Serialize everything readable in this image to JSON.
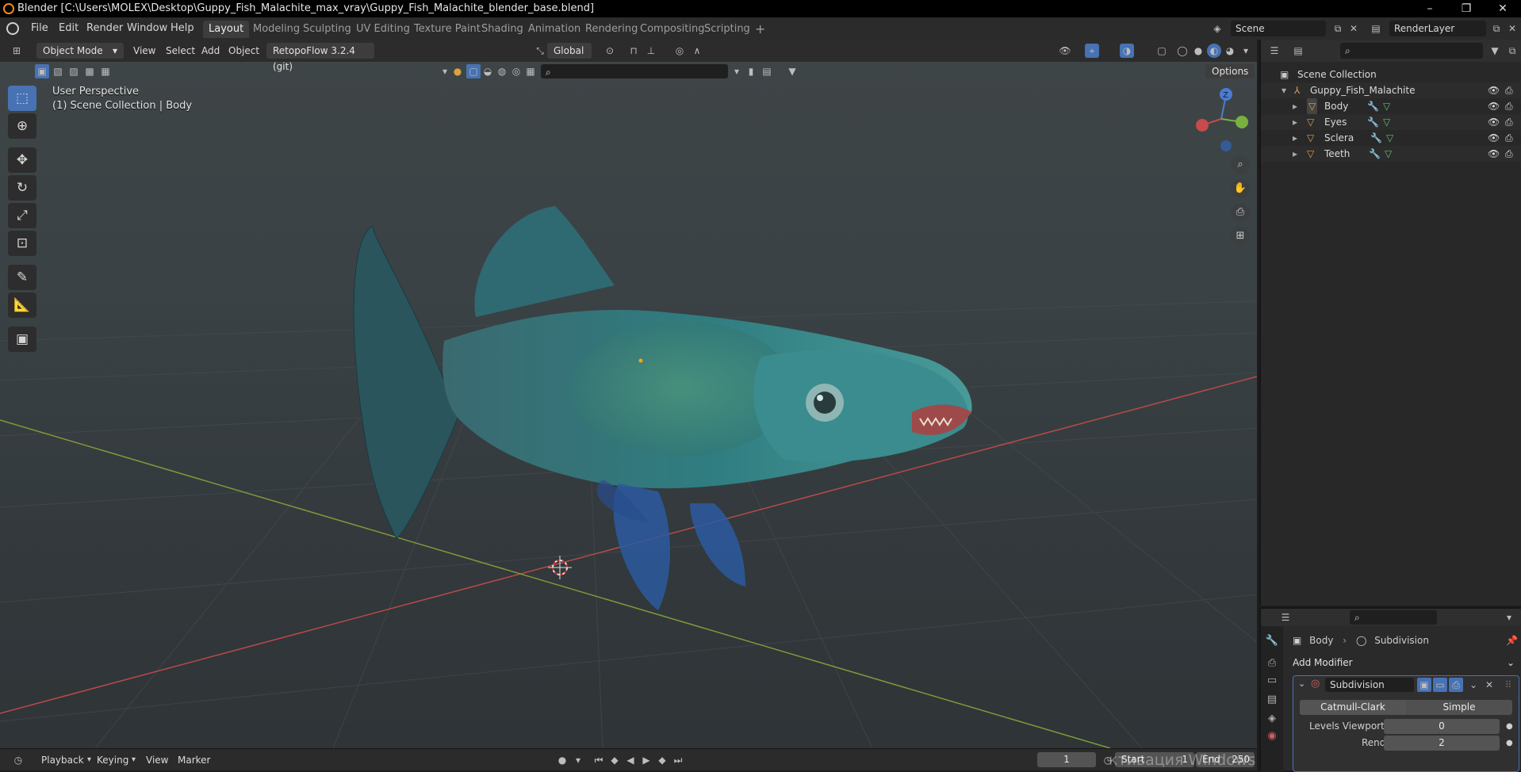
{
  "window": {
    "title": "Blender [C:\\Users\\MOLEX\\Desktop\\Guppy_Fish_Malachite_max_vray\\Guppy_Fish_Malachite_blender_base.blend]",
    "minimize": "–",
    "restore": "❐",
    "close": "✕"
  },
  "menu": {
    "file": "File",
    "edit": "Edit",
    "render": "Render",
    "window": "Window",
    "help": "Help"
  },
  "workspaces": [
    "Layout",
    "Modeling",
    "Sculpting",
    "UV Editing",
    "Texture Paint",
    "Shading",
    "Animation",
    "Rendering",
    "Compositing",
    "Scripting"
  ],
  "add_workspace": "+",
  "scene": {
    "label": "Scene",
    "layer": "RenderLayer"
  },
  "viewport": {
    "mode": "Object Mode",
    "menus": {
      "view": "View",
      "select": "Select",
      "add": "Add",
      "object": "Object"
    },
    "addon": "RetopoFlow 3.2.4 (git)",
    "orientation": "Global",
    "options": "Options",
    "perspective": "User Perspective",
    "collection_info": "(1) Scene Collection | Body",
    "gizmo": {
      "z": "Z"
    }
  },
  "outliner": {
    "root": "Scene Collection",
    "collection": "Guppy_Fish_Malachite",
    "items": [
      {
        "name": "Body"
      },
      {
        "name": "Eyes"
      },
      {
        "name": "Sclera"
      },
      {
        "name": "Teeth"
      }
    ]
  },
  "properties": {
    "breadcrumb_object": "Body",
    "breadcrumb_modifier": "Subdivision",
    "add_modifier": "Add Modifier",
    "modifier_name": "Subdivision",
    "type_catmull": "Catmull-Clark",
    "type_simple": "Simple",
    "levels_viewport_label": "Levels Viewport",
    "levels_viewport_value": "0",
    "render_label": "Render",
    "render_value": "2"
  },
  "timeline": {
    "playback": "Playback",
    "keying": "Keying",
    "view": "View",
    "marker": "Marker",
    "current_frame": "1",
    "start_label": "Start",
    "start_value": "1",
    "end_label": "End",
    "end_value": "250",
    "watermark": "ктивация Windows"
  },
  "colors": {
    "accent": "#4772b3",
    "fish_body": "#2f7d80",
    "fish_fin": "#2c5f68",
    "axis_x": "#c24a4a",
    "axis_y": "#8aa83a"
  }
}
